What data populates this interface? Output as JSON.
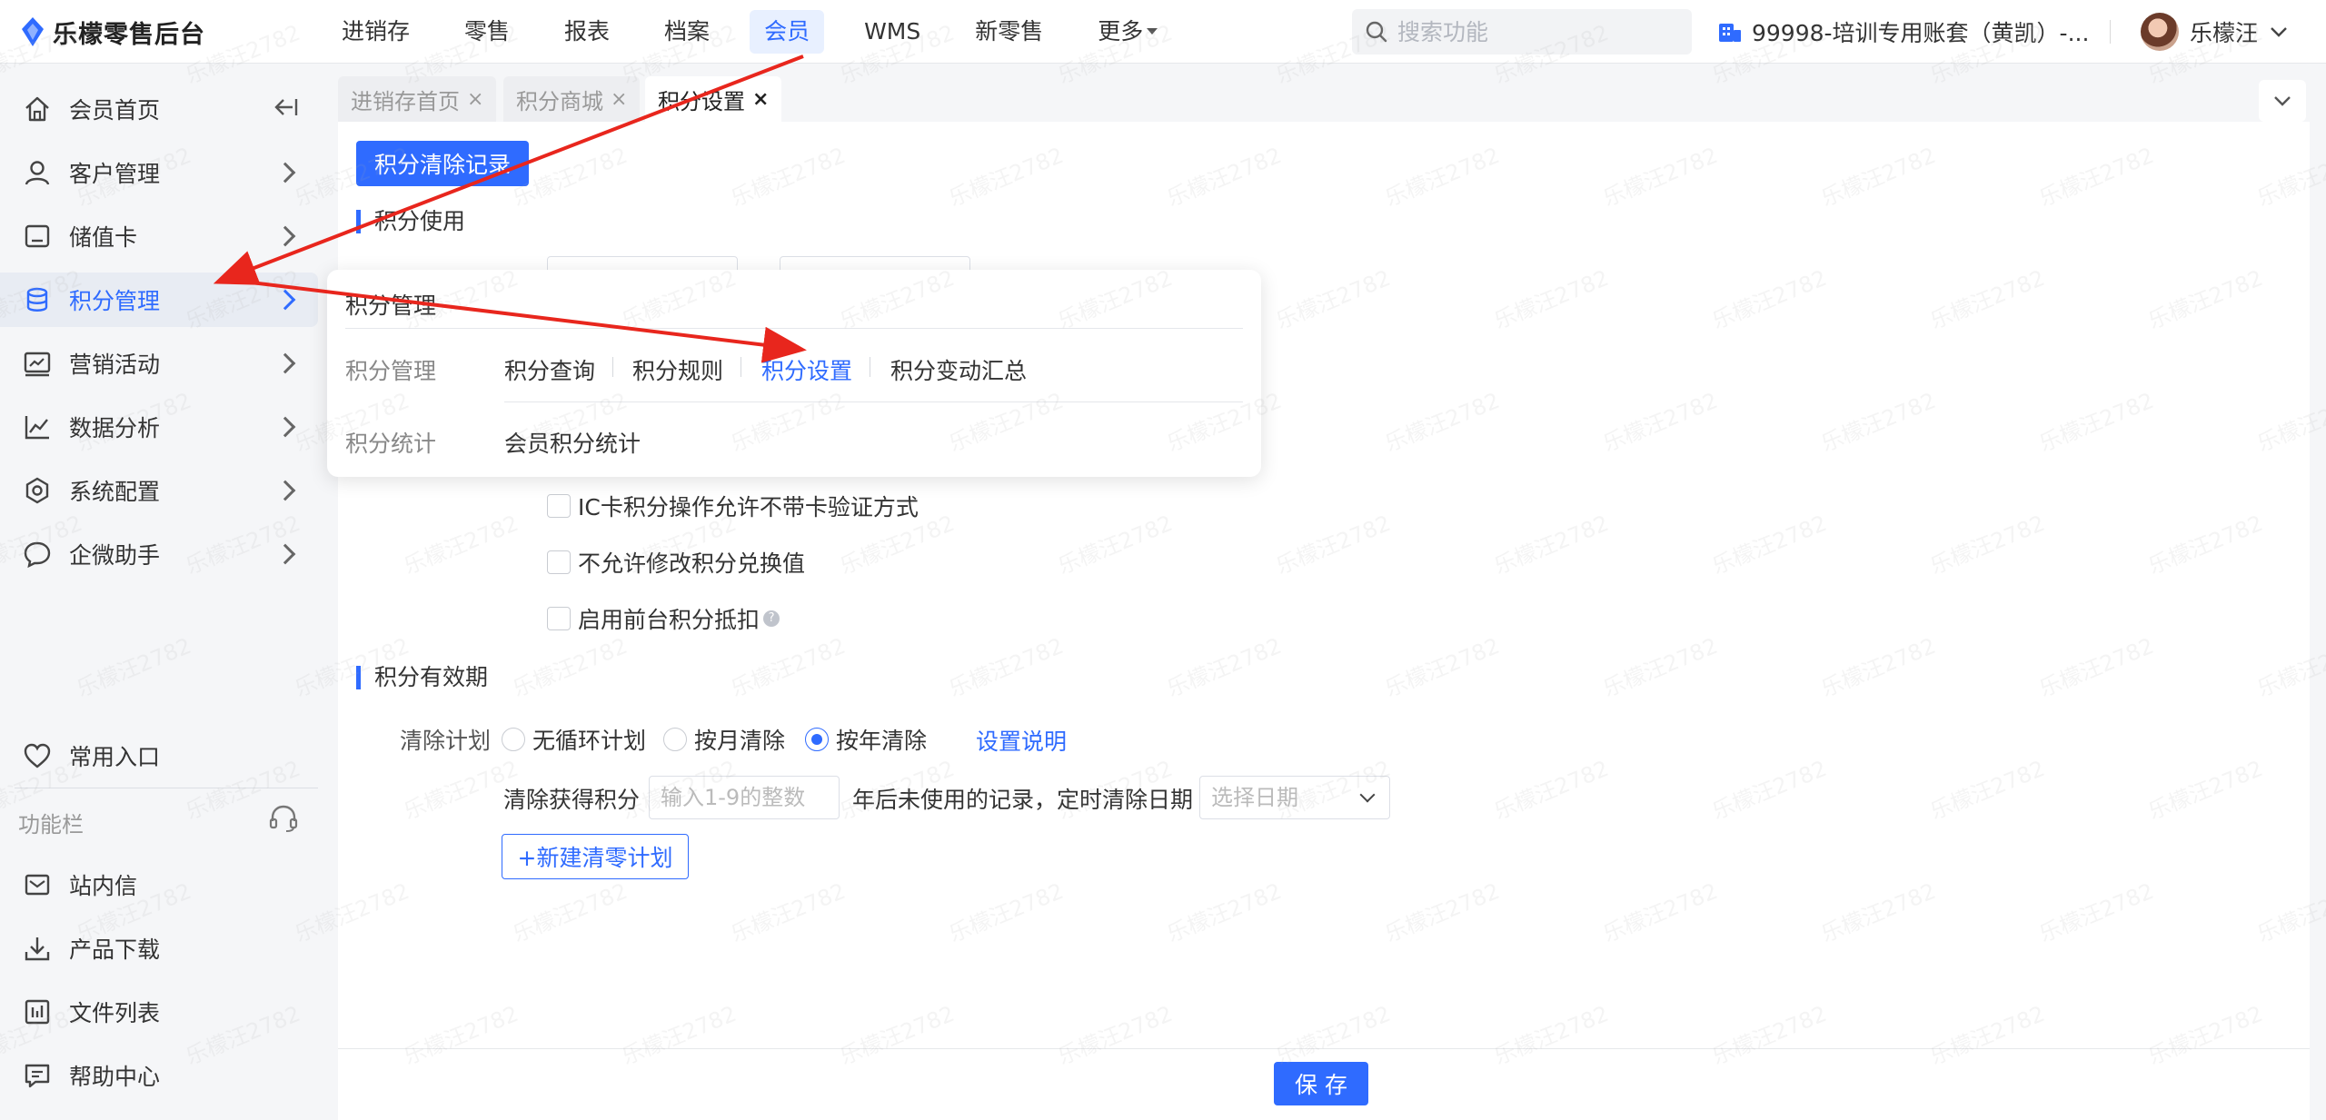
{
  "app": {
    "logo_text": "乐檬零售后台",
    "nav": [
      {
        "label": "进销存"
      },
      {
        "label": "零售"
      },
      {
        "label": "报表"
      },
      {
        "label": "档案"
      },
      {
        "label": "会员",
        "active": true
      },
      {
        "label": "WMS"
      },
      {
        "label": "新零售"
      },
      {
        "label": "更多"
      }
    ],
    "search_placeholder": "搜索功能",
    "account_label": "99998-培训专用账套（黄凯）-...",
    "user_name": "乐檬汪",
    "accent_color": "#2f6bff",
    "arrow_color": "#e8261d"
  },
  "sidebar": {
    "items": [
      {
        "label": "会员首页",
        "icon": "home-icon"
      },
      {
        "label": "客户管理",
        "icon": "user-icon"
      },
      {
        "label": "储值卡",
        "icon": "card-icon"
      },
      {
        "label": "积分管理",
        "icon": "database-icon",
        "active": true
      },
      {
        "label": "营销活动",
        "icon": "chart-board-icon"
      },
      {
        "label": "数据分析",
        "icon": "line-chart-icon"
      },
      {
        "label": "系统配置",
        "icon": "settings-hex-icon"
      },
      {
        "label": "企微助手",
        "icon": "chat-icon"
      }
    ],
    "favorites_label": "常用入口",
    "section_label": "功能栏",
    "tools": [
      {
        "label": "站内信",
        "icon": "mail-icon"
      },
      {
        "label": "产品下载",
        "icon": "download-icon"
      },
      {
        "label": "文件列表",
        "icon": "file-list-icon"
      },
      {
        "label": "帮助中心",
        "icon": "help-chat-icon"
      }
    ]
  },
  "tabs": [
    {
      "label": "进销存首页",
      "close": "×"
    },
    {
      "label": "积分商城",
      "close": "×"
    },
    {
      "label": "积分设置",
      "close": "×",
      "active": true
    }
  ],
  "content": {
    "clear_records_button": "积分清除记录",
    "section_usage": "积分使用",
    "options": [
      {
        "label": "IC卡积分操作允许不带卡验证方式",
        "checked": false
      },
      {
        "label": "不允许修改积分兑换值",
        "checked": false
      },
      {
        "label": "启用前台积分抵扣",
        "checked": false,
        "help": "?"
      }
    ],
    "section_validity": "积分有效期",
    "clear_plan_label": "清除计划",
    "clear_plan_options": [
      {
        "label": "无循环计划",
        "checked": false
      },
      {
        "label": "按月清除",
        "checked": false
      },
      {
        "label": "按年清除",
        "checked": true
      }
    ],
    "settings_help_link": "设置说明",
    "clear_obtained_label": "清除获得积分",
    "years_placeholder": "输入1-9的整数",
    "years_suffix": "年后未使用的记录，定时清除日期",
    "date_placeholder": "选择日期",
    "new_plan_button": "+新建清零计划",
    "save_button": "保 存"
  },
  "flyout": {
    "title": "积分管理",
    "groups": [
      {
        "label": "积分管理",
        "links": [
          {
            "label": "积分查询"
          },
          {
            "label": "积分规则"
          },
          {
            "label": "积分设置",
            "active": true
          },
          {
            "label": "积分变动汇总"
          }
        ]
      },
      {
        "label": "积分统计",
        "links": [
          {
            "label": "会员积分统计"
          }
        ]
      }
    ]
  },
  "watermark": "乐檬汪2782"
}
